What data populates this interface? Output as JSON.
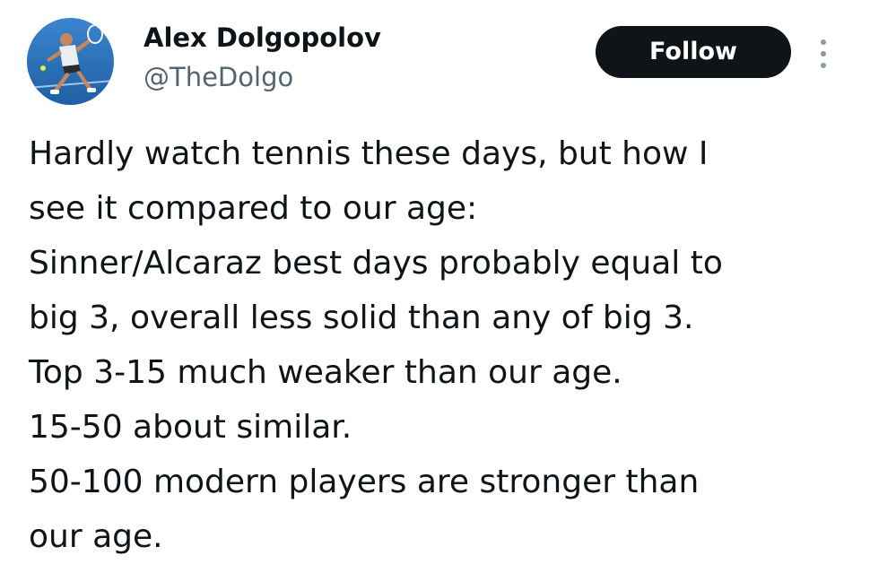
{
  "author": {
    "name": "Alex Dolgopolov",
    "handle": "@TheDolgo",
    "avatar_icon": "avatar-tennis-player-photo"
  },
  "actions": {
    "follow_label": "Follow",
    "more_icon": "vertical-ellipsis-icon"
  },
  "tweet": {
    "lines": [
      "Hardly watch tennis these days, but how I",
      "see it compared to our age:",
      "Sinner/Alcaraz best days probably equal to",
      "big 3, overall less solid than any of big 3.",
      "Top 3-15 much weaker than our age.",
      "15-50 about similar.",
      "50-100 modern players are stronger than",
      "our age."
    ]
  },
  "colors": {
    "text_primary": "#0f1419",
    "text_secondary": "#536471",
    "follow_bg": "#0f1419",
    "follow_text": "#ffffff",
    "avatar_bg": "#2a6fb8"
  }
}
